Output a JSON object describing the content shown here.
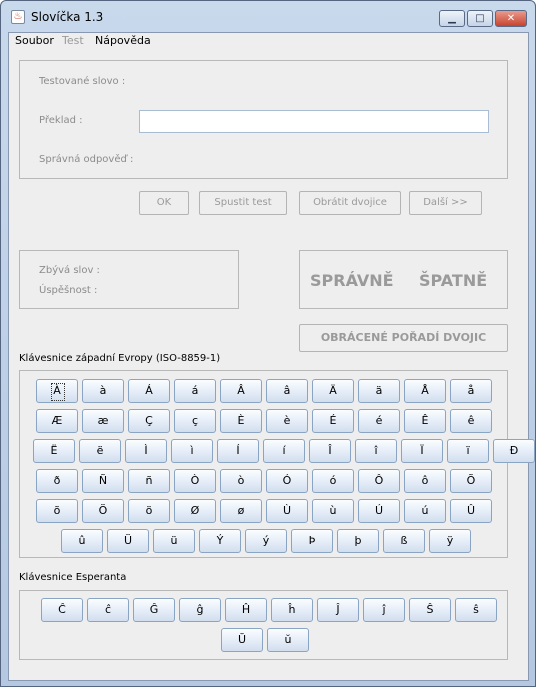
{
  "window": {
    "title": "Slovíčka 1.3",
    "app_icon": "java-coffee-icon",
    "controls": {
      "minimize": "▭",
      "maximize": "□",
      "close": "✕"
    }
  },
  "menu": [
    {
      "label": "Soubor",
      "enabled": true
    },
    {
      "label": "Test",
      "enabled": false
    },
    {
      "label": "Nápověda",
      "enabled": true
    }
  ],
  "test": {
    "word_label": "Testované slovo :",
    "translation_label": "Překlad :",
    "translation_value": "",
    "correct_label": "Správná odpověď :"
  },
  "buttons": {
    "ok": "OK",
    "start": "Spustit test",
    "reverse": "Obrátit dvojice",
    "next": "Další >>"
  },
  "stats": {
    "remaining_label": "Zbývá slov :",
    "success_label": "Úspěšnost :"
  },
  "result": {
    "correct": "SPRÁVNĚ",
    "wrong": "ŠPATNĚ"
  },
  "reverse_indicator": "OBRÁCENÉ POŘADÍ DVOJIC",
  "keyboards": {
    "western": {
      "title": "Klávesnice západní Evropy (ISO-8859-1)",
      "rows": [
        [
          "À",
          "à",
          "Á",
          "á",
          "Â",
          "â",
          "Ä",
          "ä",
          "Å",
          "å"
        ],
        [
          "Æ",
          "æ",
          "Ç",
          "ç",
          "È",
          "è",
          "É",
          "é",
          "Ê",
          "ê"
        ],
        [
          "Ë",
          "ë",
          "Ì",
          "ì",
          "Í",
          "í",
          "Î",
          "î",
          "Ï",
          "ï",
          "Ð"
        ],
        [
          "ð",
          "Ñ",
          "ñ",
          "Ò",
          "ò",
          "Ó",
          "ó",
          "Ô",
          "ô",
          "Õ"
        ],
        [
          "õ",
          "Ö",
          "ö",
          "Ø",
          "ø",
          "Ù",
          "ù",
          "Ú",
          "ú",
          "Û"
        ],
        [
          "û",
          "Ü",
          "ü",
          "Ý",
          "ý",
          "Þ",
          "þ",
          "ß",
          "ÿ"
        ]
      ]
    },
    "esperanto": {
      "title": "Klávesnice Esperanta",
      "rows": [
        [
          "Ĉ",
          "ĉ",
          "Ĝ",
          "ĝ",
          "Ĥ",
          "ĥ",
          "Ĵ",
          "ĵ",
          "Ŝ",
          "ŝ"
        ],
        [
          "Ŭ",
          "ŭ"
        ]
      ]
    }
  },
  "colors": {
    "window_frame": "#b4c8e2",
    "panel_bg": "#eeeeee",
    "disabled_text": "#9a9a9a",
    "key_border": "#8aa4c4"
  }
}
